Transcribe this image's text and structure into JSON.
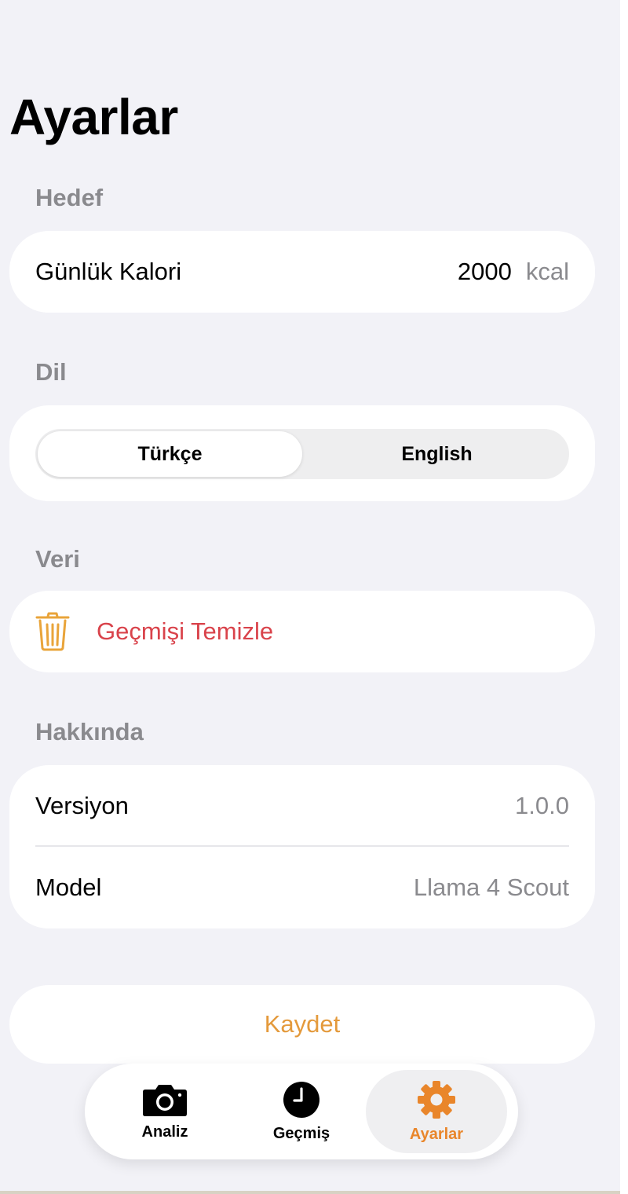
{
  "page": {
    "title": "Ayarlar"
  },
  "sections": {
    "goal": {
      "header": "Hedef",
      "daily_calorie_label": "Günlük Kalori",
      "daily_calorie_value": "2000",
      "daily_calorie_unit": "kcal"
    },
    "language": {
      "header": "Dil",
      "options": [
        "Türkçe",
        "English"
      ],
      "selected": "Türkçe"
    },
    "data": {
      "header": "Veri",
      "clear_history_label": "Geçmişi Temizle",
      "clear_icon": "trash-icon"
    },
    "about": {
      "header": "Hakkında",
      "version_label": "Versiyon",
      "version_value": "1.0.0",
      "model_label": "Model",
      "model_value": "Llama 4 Scout"
    }
  },
  "save_label": "Kaydet",
  "tab_bar": {
    "items": [
      {
        "label": "Analiz",
        "icon": "camera-icon",
        "active": false
      },
      {
        "label": "Geçmiş",
        "icon": "clock-icon",
        "active": false
      },
      {
        "label": "Ayarlar",
        "icon": "gear-icon",
        "active": true
      }
    ]
  },
  "colors": {
    "background": "#f2f2f7",
    "card": "#ffffff",
    "secondary_text": "#8a8a8e",
    "destructive": "#d9434b",
    "accent": "#e9862b",
    "save_text": "#e49a3c"
  }
}
